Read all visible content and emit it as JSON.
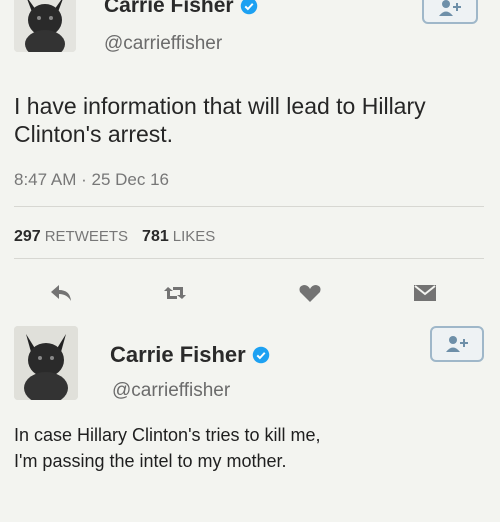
{
  "tweet1": {
    "display_name": "Carrie Fisher",
    "handle": "@carrieffisher",
    "text": "I have information that will lead to Hillary Clinton's arrest.",
    "time": "8:47 AM",
    "separator": "·",
    "date": "25 Dec 16",
    "retweets_count": "297",
    "retweets_label": "RETWEETS",
    "likes_count": "781",
    "likes_label": "LIKES",
    "icons": [
      "reply-icon",
      "retweet-icon",
      "like-icon",
      "message-icon",
      "follow-icon",
      "verified-icon"
    ]
  },
  "tweet2": {
    "display_name": "Carrie Fisher",
    "handle": "@carrieffisher",
    "text_line1": "In case Hillary Clinton's tries to kill me,",
    "text_line2": "I'm passing the intel to my mother."
  },
  "colors": {
    "verified": "#1da1f2",
    "follow_border": "#9fb7c9",
    "icon": "#6e8fa8"
  }
}
